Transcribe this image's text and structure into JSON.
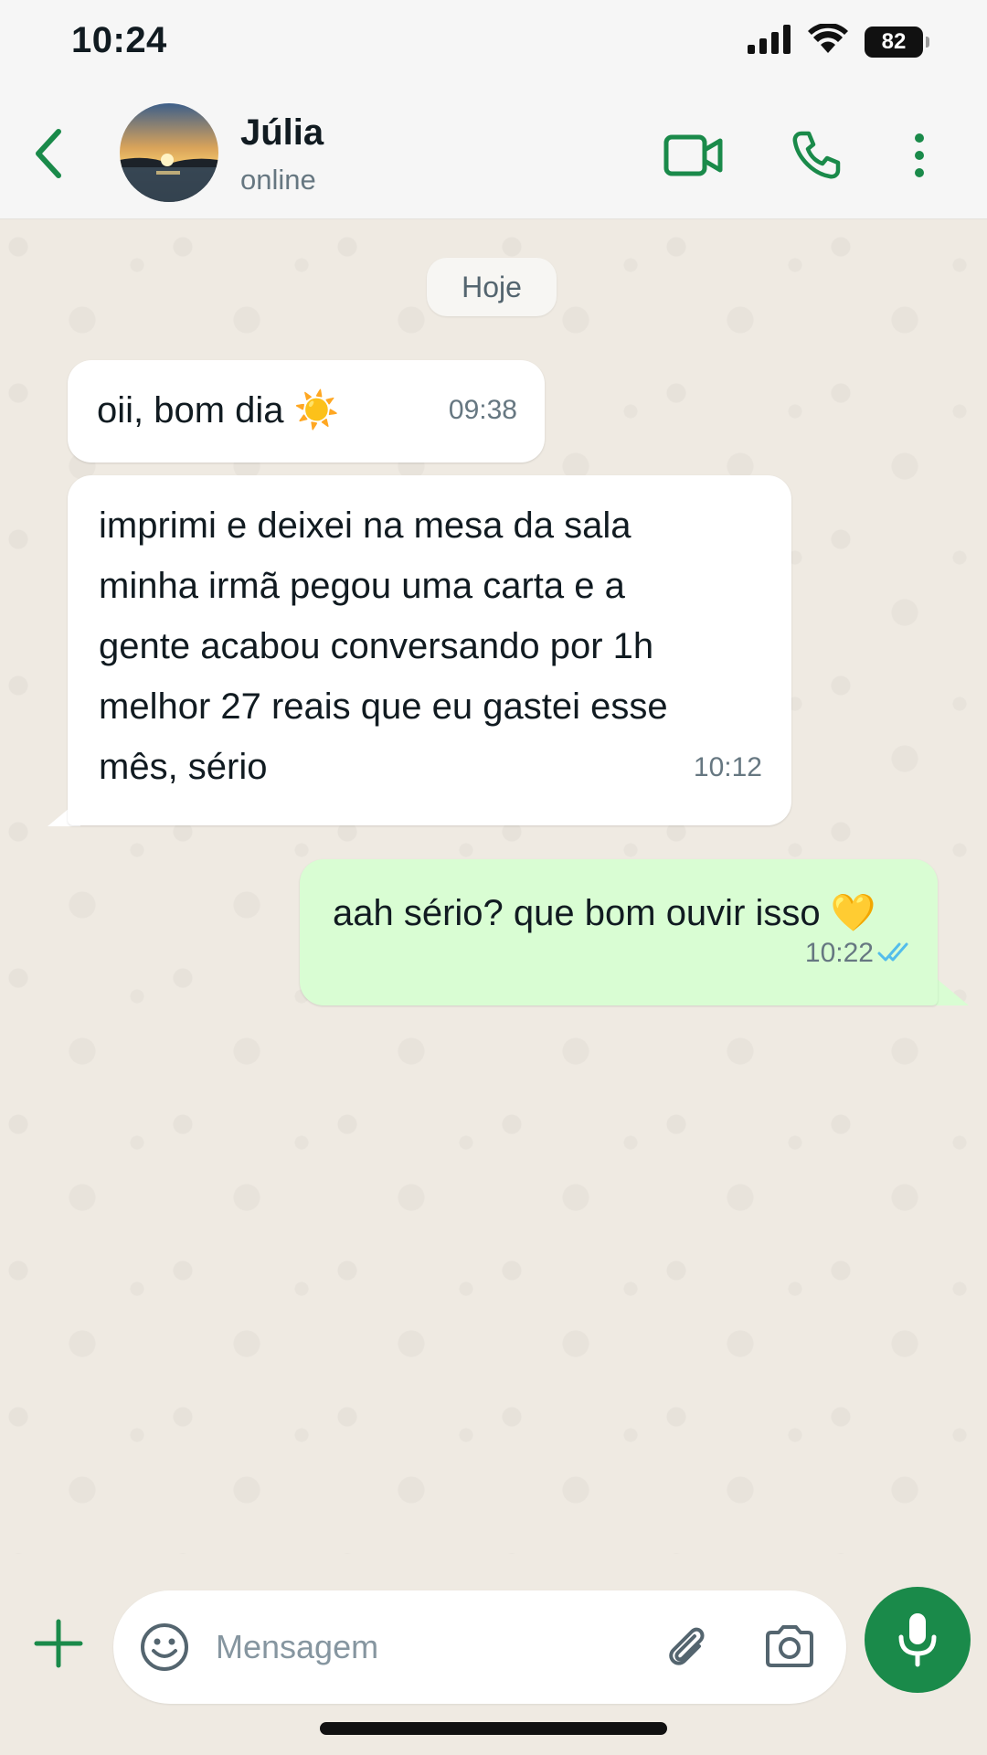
{
  "status_bar": {
    "time": "10:24",
    "battery": "82"
  },
  "header": {
    "contact_name": "Júlia",
    "contact_status": "online"
  },
  "chat": {
    "date_chip": "Hoje",
    "messages": [
      {
        "direction": "incoming",
        "text": "oii, bom dia ☀️",
        "time": "09:38"
      },
      {
        "direction": "incoming",
        "text": "imprimi e deixei na mesa da sala\nminha irmã pegou uma carta e a\ngente acabou conversando por 1h\nmelhor 27 reais que eu gastei esse\nmês, sério",
        "time": "10:12"
      },
      {
        "direction": "outgoing",
        "text": "aah sério? que bom ouvir isso 💛",
        "time": "10:22",
        "status": "read"
      }
    ]
  },
  "input": {
    "placeholder": "Mensagem"
  },
  "colors": {
    "accent": "#1a8a4a",
    "outgoing_bubble": "#d9fdd3",
    "incoming_bubble": "#ffffff",
    "read_ticks": "#53bdeb",
    "chat_background": "#efeae2"
  }
}
